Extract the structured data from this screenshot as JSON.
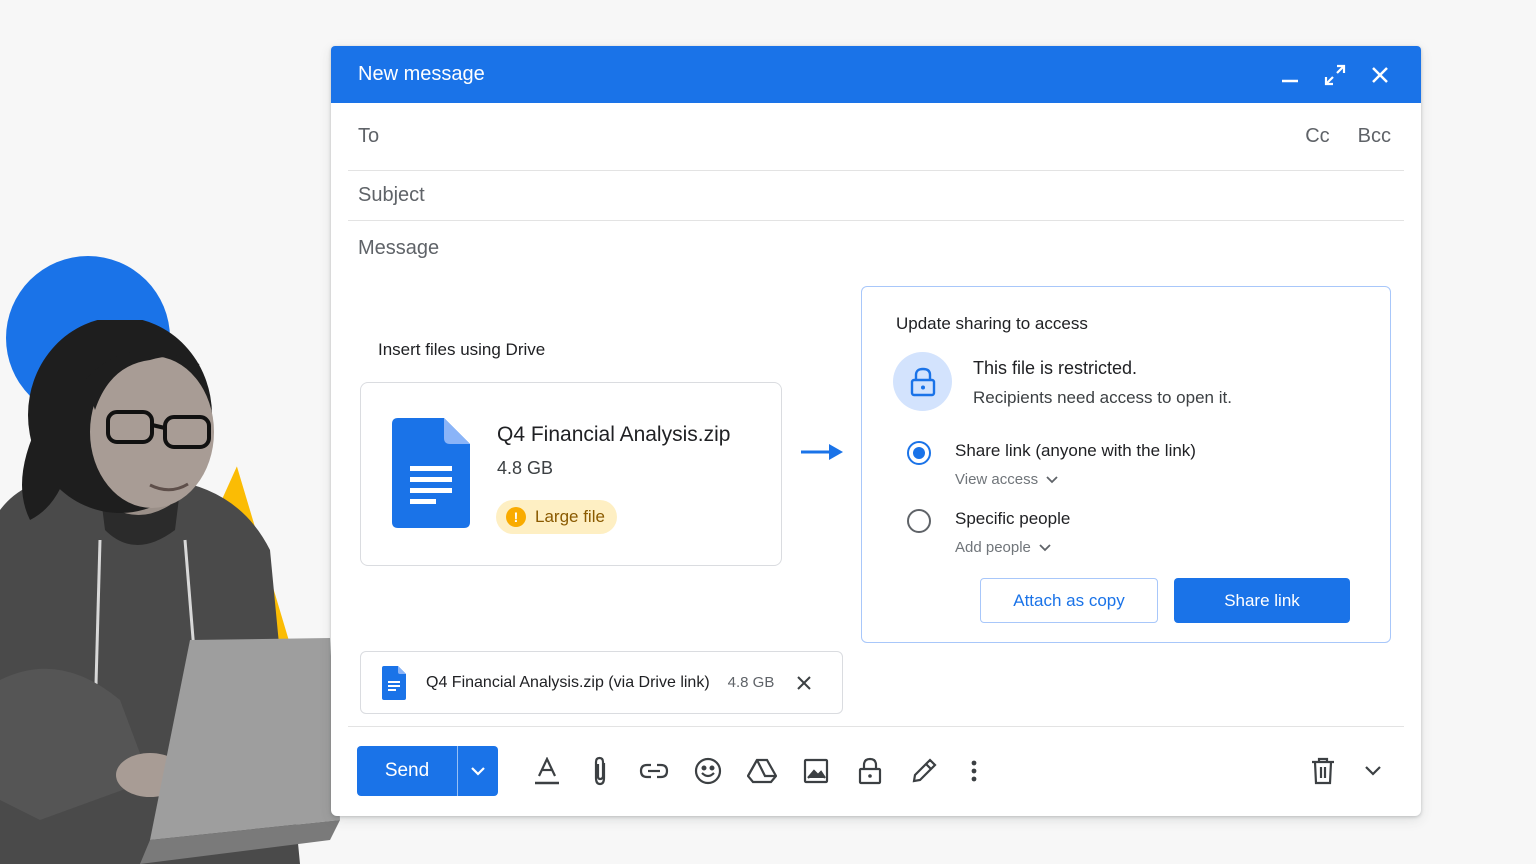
{
  "window": {
    "title": "New message",
    "accent_color": "#1a73e8"
  },
  "recipients": {
    "to_label": "To",
    "cc_label": "Cc",
    "bcc_label": "Bcc"
  },
  "subject": {
    "placeholder": "Subject"
  },
  "message": {
    "placeholder": "Message"
  },
  "drive_insert": {
    "label": "Insert files using Drive",
    "file_name": "Q4 Financial Analysis.zip",
    "file_size": "4.8 GB",
    "badge_label": "Large file",
    "badge_icon": "!"
  },
  "sharing_panel": {
    "title": "Update sharing to access",
    "restricted_title": "This file is restricted.",
    "restricted_subtitle": "Recipients need access to open it.",
    "options": [
      {
        "label": "Share link (anyone with the link)",
        "sub_label": "View access",
        "selected": true
      },
      {
        "label": "Specific people",
        "sub_label": "Add people",
        "selected": false
      }
    ],
    "attach_copy_label": "Attach as copy",
    "share_link_label": "Share link"
  },
  "attachment": {
    "name": "Q4 Financial Analysis.zip (via Drive link)",
    "size": "4.8 GB"
  },
  "toolbar": {
    "send_label": "Send",
    "icons": [
      "formatting-icon",
      "attach-icon",
      "link-icon",
      "emoji-icon",
      "drive-icon",
      "photo-icon",
      "confidential-icon",
      "signature-icon",
      "more-options-icon",
      "trash-icon",
      "chevron-down-icon"
    ]
  }
}
